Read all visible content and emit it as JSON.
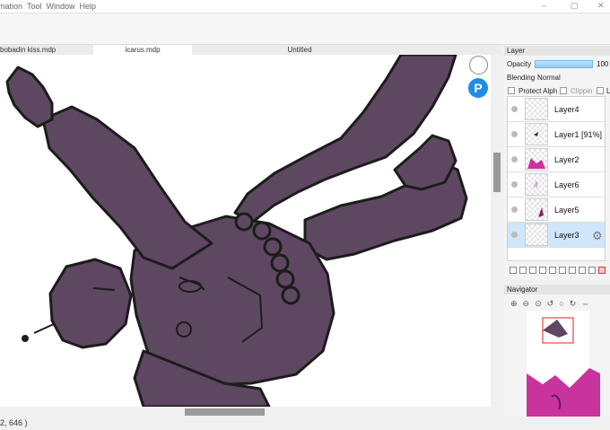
{
  "menubar": {
    "items": [
      "mation",
      "Tool",
      "Window",
      "Help"
    ]
  },
  "window_controls": {
    "minimize": "–",
    "maximize": "▢",
    "close": "✕"
  },
  "tabs": [
    {
      "label": "bobadin kiss.mdp"
    },
    {
      "label": "icarus.mdp"
    },
    {
      "label": "Untitled"
    }
  ],
  "floating": {
    "pixiv_label": "P"
  },
  "status": {
    "text": "2, 646 )"
  },
  "layer_panel": {
    "title": "Layer",
    "opacity_label": "Opacity",
    "opacity_value": "100",
    "opacity_fraction": 1.0,
    "blending_label": "Blending",
    "blending_value": "Normal",
    "protect_alpha": "Protect Alph",
    "clipping": "Clippin",
    "lock": "L",
    "layers": [
      {
        "name": "Layer4",
        "selected": false
      },
      {
        "name": "Layer1  [91%]",
        "selected": false
      },
      {
        "name": "Layer2",
        "selected": false
      },
      {
        "name": "Layer6",
        "selected": false
      },
      {
        "name": "Layer5",
        "selected": false
      },
      {
        "name": "Layer3",
        "selected": true
      }
    ]
  },
  "navigator": {
    "title": "Navigator"
  },
  "colors": {
    "figure": "#5e4760",
    "outline": "#1c1c1c",
    "accent": "#1d8de8",
    "selection": "#cfe6fb",
    "magenta": "#c9339d"
  }
}
